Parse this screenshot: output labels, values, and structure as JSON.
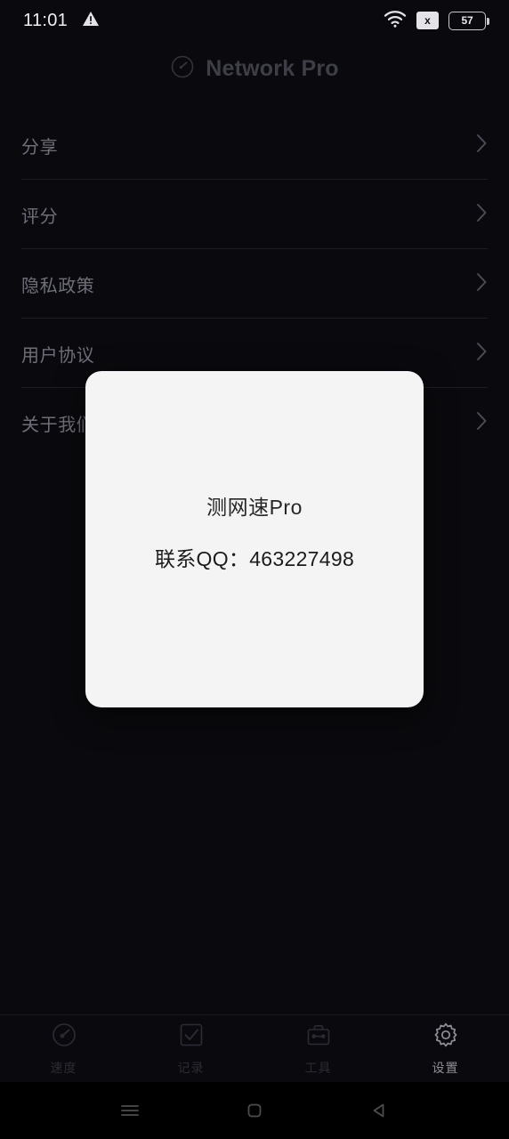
{
  "status_bar": {
    "time": "11:01",
    "warning_icon": "warning-triangle-icon",
    "wifi_icon": "wifi-icon",
    "sim_badge": "x",
    "battery_level": "57"
  },
  "app_header": {
    "logo_icon": "speedometer-logo-icon",
    "title": "Network Pro"
  },
  "settings_list": {
    "items": [
      {
        "label": "分享",
        "icon": "chevron-right-icon"
      },
      {
        "label": "评分",
        "icon": "chevron-right-icon"
      },
      {
        "label": "隐私政策",
        "icon": "chevron-right-icon"
      },
      {
        "label": "用户协议",
        "icon": "chevron-right-icon"
      },
      {
        "label": "关于我们",
        "icon": "chevron-right-icon"
      }
    ]
  },
  "dialog": {
    "title": "测网速Pro",
    "contact": "联系QQ：463227498",
    "background_color": "#f4f4f4"
  },
  "tab_bar": {
    "tabs": [
      {
        "label": "速度",
        "icon": "speedometer-icon",
        "active": false
      },
      {
        "label": "记录",
        "icon": "checkbox-check-icon",
        "active": false
      },
      {
        "label": "工具",
        "icon": "toolbox-icon",
        "active": false
      },
      {
        "label": "设置",
        "icon": "gear-icon",
        "active": true
      }
    ],
    "active_color": "#8e8e98",
    "inactive_color": "#2b2b34"
  },
  "android_nav": {
    "recents_icon": "menu-lines-icon",
    "home_icon": "home-square-icon",
    "back_icon": "back-triangle-icon"
  },
  "theme": {
    "background": "#0a0a0e",
    "divider": "#1d1d24",
    "list_text": "#6e6e78"
  }
}
